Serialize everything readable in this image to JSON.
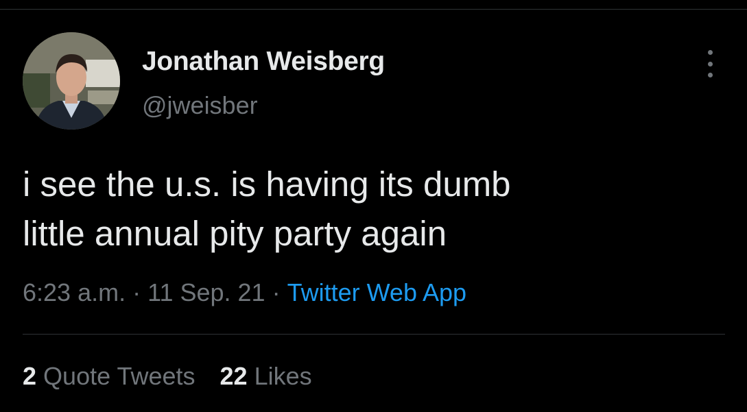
{
  "tweet": {
    "author": {
      "display_name": "Jonathan Weisberg",
      "handle": "@jweisber",
      "avatar": "profile-photo"
    },
    "text_lines": [
      "i see the u.s. is having its dumb",
      "little annual pity party again"
    ],
    "time": "6:23 a.m.",
    "date": "11 Sep. 21",
    "separator": "·",
    "source": "Twitter Web App",
    "stats": {
      "quote_tweets_count": "2",
      "quote_tweets_label": "Quote Tweets",
      "likes_count": "22",
      "likes_label": "Likes"
    },
    "more_icon": "more-vertical-icon"
  },
  "colors": {
    "background": "#000000",
    "primary_text": "#e7e9ea",
    "secondary_text": "#71767b",
    "link": "#1d9bf0",
    "divider": "#2f3336"
  }
}
